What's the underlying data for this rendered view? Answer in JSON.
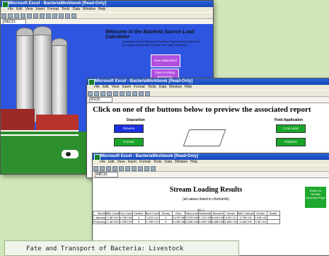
{
  "windows": {
    "w1": {
      "title": "Microsoft Excel - BacteriaWorkbook  [Read-Only]",
      "menu": [
        "File",
        "Edit",
        "View",
        "Insert",
        "Format",
        "Tools",
        "Data",
        "Window",
        "Help"
      ],
      "namebox": "REC21",
      "welcome": "Welcome to the Bacteria Source Load Calculator",
      "subtitle": "developed by the Biological Systems Engineering Department at Virginia Polytechnic Institute and State University",
      "buttons": [
        "New Watershed",
        "Open Existing Watershed"
      ]
    },
    "w2": {
      "title": "Microsoft Excel - BacteriaWorkbook  [Read-Only]",
      "menu": [
        "File",
        "Edit",
        "View",
        "Insert",
        "Format",
        "Tools",
        "Data",
        "Window",
        "Help"
      ],
      "namebox": "R1C8",
      "heading": "Click on one of the buttons below to preview the associated report",
      "col1": "Deposition",
      "col2": "Field Application",
      "btn_streams": "Streams",
      "btn_forests": "Forests",
      "btn_croplands": "Crop Land",
      "btn_pastures": "Pastures",
      "colors": {
        "blue": "#1b2fe0",
        "green": "#1aa52a"
      }
    },
    "w3": {
      "title": "Microsoft Excel - BacteriaWorkbook  [Read-Only]",
      "menu": [
        "File",
        "Edit",
        "View",
        "Insert",
        "Format",
        "Tools",
        "Data",
        "Window",
        "Help"
      ],
      "namebox": "R8C15",
      "heading": "Stream Loading Results",
      "sub": "(all values listed in cfu/month)",
      "return_button": "Return to Results Summary Page",
      "nc_label": "NC-1",
      "headers": [
        "Month",
        "Milk Cows",
        "Dry Cows",
        "Heifers",
        "Beef Cows",
        "Sheep",
        "Deer",
        "Raccoons",
        "Muskrats",
        "Beavers",
        "Geese",
        "Wild Turkeys",
        "Ducks",
        "Boats"
      ],
      "rows": [
        [
          "January",
          "1.6E+09",
          "5.70E+08",
          "0",
          "1.67E+10",
          "0",
          "3.47E+08",
          "3.57E+08",
          "2.71E+09",
          "6.51E+08",
          "6.2E+10",
          "5.73E+09",
          "1.03E+11",
          ""
        ],
        [
          "February",
          "1.4E+09",
          "5.25E+09",
          "0",
          "1.79E+10",
          "0",
          "3.15E+08",
          "3.23E+08",
          "2.45E+09",
          "5.88E+08",
          "4.63E+10",
          "5.18E+09",
          "9.3E+10",
          ""
        ]
      ]
    }
  },
  "caption": "Fate and Transport of Bacteria: Livestock"
}
